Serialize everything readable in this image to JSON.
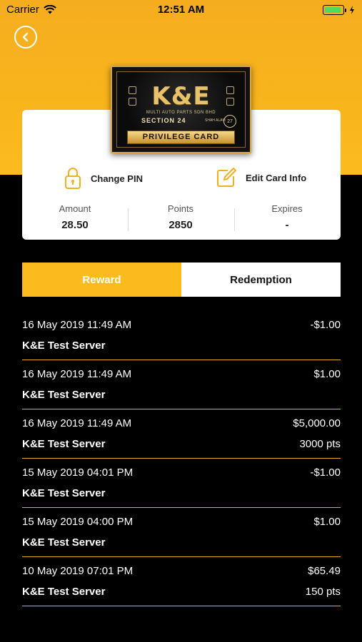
{
  "status_bar": {
    "carrier": "Carrier",
    "time": "12:51 AM",
    "battery_color": "#4cd964"
  },
  "colors": {
    "accent": "#fbbb1f",
    "background": "#000000",
    "card": "#ffffff"
  },
  "card_image": {
    "brand": "K&E",
    "company": "MULTI AUTO PARTS SDN BHD",
    "section": "SECTION 24",
    "location": "SHAH ALAM",
    "badge": "27",
    "card_type": "PRIVILEGE CARD"
  },
  "actions": {
    "change_pin": "Change PIN",
    "edit_card_info": "Edit Card Info"
  },
  "stats": {
    "amount_label": "Amount",
    "amount_value": "28.50",
    "points_label": "Points",
    "points_value": "2850",
    "expires_label": "Expires",
    "expires_value": "-"
  },
  "tabs": {
    "reward": "Reward",
    "redemption": "Redemption"
  },
  "transactions": [
    {
      "date": "16 May 2019 11:49 AM",
      "name": "K&E Test Server",
      "amount": "-$1.00",
      "points": ""
    },
    {
      "date": "16 May 2019 11:49 AM",
      "name": "K&E Test Server",
      "amount": "$1.00",
      "points": ""
    },
    {
      "date": "16 May 2019 11:49 AM",
      "name": "K&E Test Server",
      "amount": "$5,000.00",
      "points": "3000 pts"
    },
    {
      "date": "15 May 2019 04:01 PM",
      "name": "K&E Test Server",
      "amount": "-$1.00",
      "points": ""
    },
    {
      "date": "15 May 2019 04:00 PM",
      "name": "K&E Test Server",
      "amount": "$1.00",
      "points": ""
    },
    {
      "date": "10 May 2019 07:01 PM",
      "name": "K&E Test Server",
      "amount": "$65.49",
      "points": "150 pts"
    }
  ]
}
